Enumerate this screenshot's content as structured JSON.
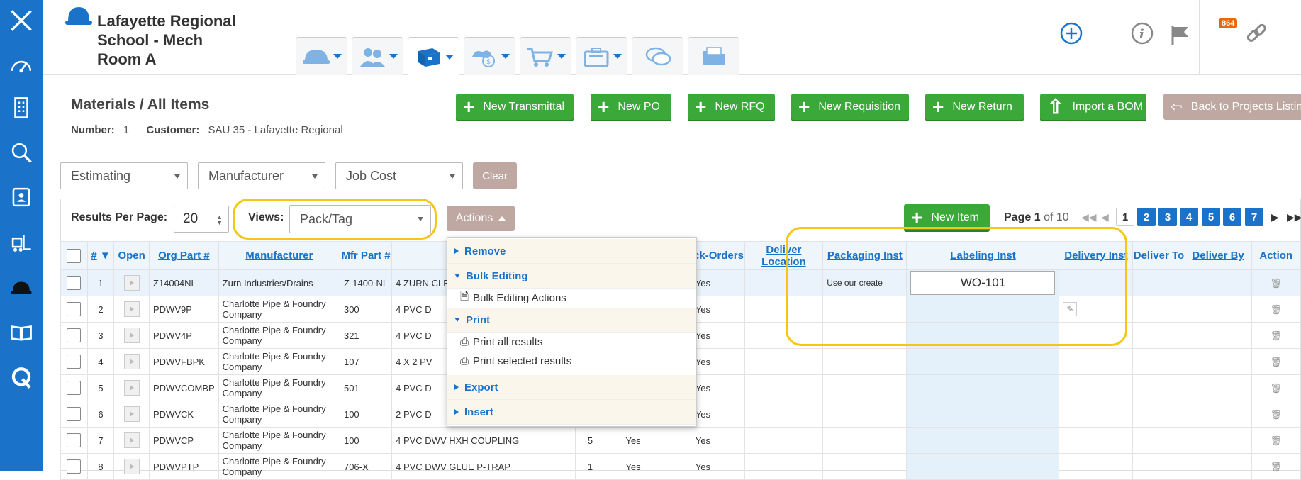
{
  "app": {
    "project_title": "Lafayette Regional School - Mech Room A",
    "notification_count": "864"
  },
  "sidebar": {
    "icons": [
      "close-icon",
      "dashboard-icon",
      "building-icon",
      "search-icon",
      "contacts-icon",
      "forklift-icon",
      "hardhat-icon",
      "book-icon",
      "logo-icon"
    ]
  },
  "module_tabs": [
    "hardhat-tab-icon",
    "workers-tab-icon",
    "materials-tab-icon",
    "money-tab-icon",
    "cart-tab-icon",
    "briefcase-tab-icon",
    "chat-tab-icon",
    "folder-tab-icon"
  ],
  "page": {
    "heading": "Materials / All Items",
    "number_label": "Number:",
    "number_value": "1",
    "customer_label": "Customer:",
    "customer_value": "SAU 35 - Lafayette Regional"
  },
  "toolbar": {
    "new_transmittal": "New Transmittal",
    "new_po": "New PO",
    "new_rfq": "New RFQ",
    "new_requisition": "New Requisition",
    "new_return": "New Return",
    "import_bom": "Import a BOM",
    "back": "Back to Projects Listing"
  },
  "filters": {
    "estimating": "Estimating",
    "manufacturer": "Manufacturer",
    "job_cost": "Job Cost",
    "clear": "Clear"
  },
  "results": {
    "per_page_label": "Results Per Page:",
    "per_page_value": "20",
    "views_label": "Views:",
    "views_value": "Pack/Tag",
    "actions_label": "Actions",
    "new_item": "New Item",
    "page_word": "Page",
    "page_current": "1",
    "page_of": "of 10",
    "pages": [
      "1",
      "2",
      "3",
      "4",
      "5",
      "6",
      "7"
    ]
  },
  "actions_menu": {
    "remove": "Remove",
    "bulk_editing": "Bulk Editing",
    "bulk_editing_actions": "Bulk Editing Actions",
    "print": "Print",
    "print_all": "Print all results",
    "print_selected": "Print selected results",
    "export": "Export",
    "insert": "Insert"
  },
  "table": {
    "headers": {
      "num": "#",
      "open": "Open",
      "org_part": "Org Part #",
      "manufacturer": "Manufacturer",
      "mfr_part": "Mfr Part #",
      "allow_back_orders": "ow Back-Orders",
      "deliver_location": "Deliver Location",
      "packaging_inst": "Packaging Inst",
      "labeling_inst": "Labeling Inst",
      "delivery_inst": "Delivery Inst",
      "deliver_to": "Deliver To",
      "deliver_by": "Deliver By",
      "actions": "Action"
    },
    "rows": [
      {
        "num": "1",
        "org_part": "Z14004NL",
        "manufacturer": "Zurn Industries/Drains",
        "mfr_part": "Z-1400-NL",
        "desc": "4 ZURN CLEANO",
        "qty": "",
        "yes1": "",
        "back": "Yes",
        "packaging": "Use our create",
        "labeling": "WO-101"
      },
      {
        "num": "2",
        "org_part": "PDWV9P",
        "manufacturer": "Charlotte Pipe & Foundry Company",
        "mfr_part": "300",
        "desc": "4 PVC D",
        "qty": "",
        "yes1": "",
        "back": "Yes",
        "packaging": "",
        "labeling": ""
      },
      {
        "num": "3",
        "org_part": "PDWV4P",
        "manufacturer": "Charlotte Pipe & Foundry Company",
        "mfr_part": "321",
        "desc": "4 PVC D",
        "qty": "",
        "yes1": "",
        "back": "Yes",
        "packaging": "",
        "labeling": ""
      },
      {
        "num": "4",
        "org_part": "PDWVFBPK",
        "manufacturer": "Charlotte Pipe & Foundry Company",
        "mfr_part": "107",
        "desc": "4 X 2 PV",
        "qty": "",
        "yes1": "",
        "back": "Yes",
        "packaging": "",
        "labeling": ""
      },
      {
        "num": "5",
        "org_part": "PDWVCOMBP",
        "manufacturer": "Charlotte Pipe & Foundry Company",
        "mfr_part": "501",
        "desc": "4 PVC D",
        "qty": "",
        "yes1": "",
        "back": "Yes",
        "packaging": "",
        "labeling": ""
      },
      {
        "num": "6",
        "org_part": "PDWVCK",
        "manufacturer": "Charlotte Pipe & Foundry Company",
        "mfr_part": "100",
        "desc": "2 PVC D",
        "qty": "",
        "yes1": "",
        "back": "Yes",
        "packaging": "",
        "labeling": ""
      },
      {
        "num": "7",
        "org_part": "PDWVCP",
        "manufacturer": "Charlotte Pipe & Foundry Company",
        "mfr_part": "100",
        "desc": "4 PVC DWV HXH COUPLING",
        "qty": "5",
        "yes1": "Yes",
        "back": "Yes",
        "packaging": "",
        "labeling": ""
      },
      {
        "num": "8",
        "org_part": "PDWVPTP",
        "manufacturer": "Charlotte Pipe & Foundry Company",
        "mfr_part": "706-X",
        "desc": "4 PVC DWV GLUE P-TRAP",
        "qty": "1",
        "yes1": "Yes",
        "back": "Yes",
        "packaging": "",
        "labeling": ""
      }
    ]
  },
  "colors": {
    "sidebar": "#1a73c8",
    "green": "#3aa93a",
    "muted_button": "#bfa8a2",
    "highlight": "#f5c518",
    "badge": "#e8690c"
  }
}
